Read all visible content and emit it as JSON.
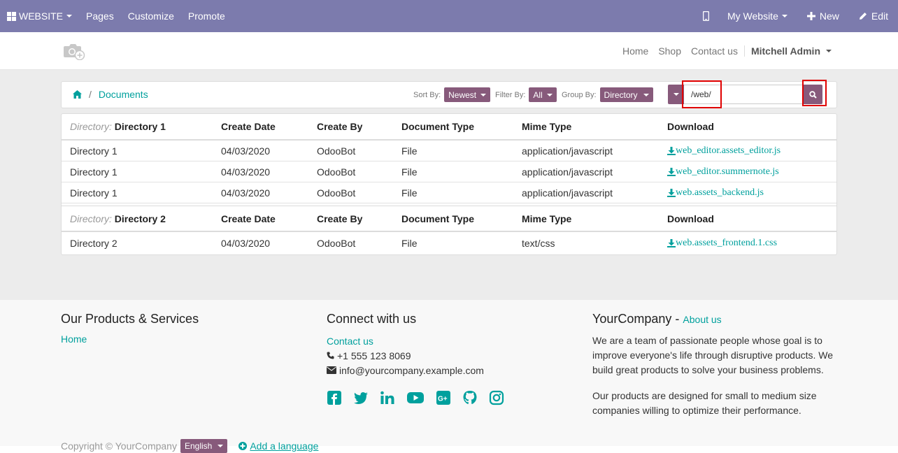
{
  "topbar": {
    "website_label": "WEBSITE",
    "pages_label": "Pages",
    "customize_label": "Customize",
    "promote_label": "Promote",
    "my_website_label": "My Website",
    "new_label": "New",
    "edit_label": "Edit"
  },
  "header": {
    "nav": [
      "Home",
      "Shop",
      "Contact us"
    ],
    "user": "Mitchell Admin"
  },
  "breadcrumb": {
    "current": "Documents"
  },
  "controls": {
    "sort_label": "Sort By:",
    "sort_value": "Newest",
    "filter_label": "Filter By:",
    "filter_value": "All",
    "group_label": "Group By:",
    "group_value": "Directory"
  },
  "search": {
    "value": "/web/"
  },
  "columns": [
    "Create Date",
    "Create By",
    "Document Type",
    "Mime Type",
    "Download"
  ],
  "groups": [
    {
      "dir_prefix": "Directory:",
      "name": "Directory 1",
      "rows": [
        {
          "directory": "Directory 1",
          "date": "04/03/2020",
          "by": "OdooBot",
          "type": "File",
          "mime": "application/javascript",
          "file": "web_editor.assets_editor.js"
        },
        {
          "directory": "Directory 1",
          "date": "04/03/2020",
          "by": "OdooBot",
          "type": "File",
          "mime": "application/javascript",
          "file": "web_editor.summernote.js"
        },
        {
          "directory": "Directory 1",
          "date": "04/03/2020",
          "by": "OdooBot",
          "type": "File",
          "mime": "application/javascript",
          "file": "web.assets_backend.js"
        }
      ]
    },
    {
      "dir_prefix": "Directory:",
      "name": "Directory 2",
      "rows": [
        {
          "directory": "Directory 2",
          "date": "04/03/2020",
          "by": "OdooBot",
          "type": "File",
          "mime": "text/css",
          "file": "web.assets_frontend.1.css"
        }
      ]
    }
  ],
  "footer": {
    "col1_title": "Our Products & Services",
    "col1_link": "Home",
    "col2_title": "Connect with us",
    "col2_link": "Contact us",
    "phone": "+1 555 123 8069",
    "email": "info@yourcompany.example.com",
    "col3_title": "YourCompany",
    "col3_dash": " - ",
    "col3_link": "About us",
    "about_p1": "We are a team of passionate people whose goal is to improve everyone's life through disruptive products. We build great products to solve your business problems.",
    "about_p2": "Our products are designed for small to medium size companies willing to optimize their performance.",
    "copyright": "Copyright © YourCompany",
    "language": "English",
    "add_language": "Add a language"
  },
  "colors": {
    "topbar": "#7c7bad",
    "accent": "#00a09d",
    "pill": "#875a7b",
    "highlight": "#e00000"
  }
}
